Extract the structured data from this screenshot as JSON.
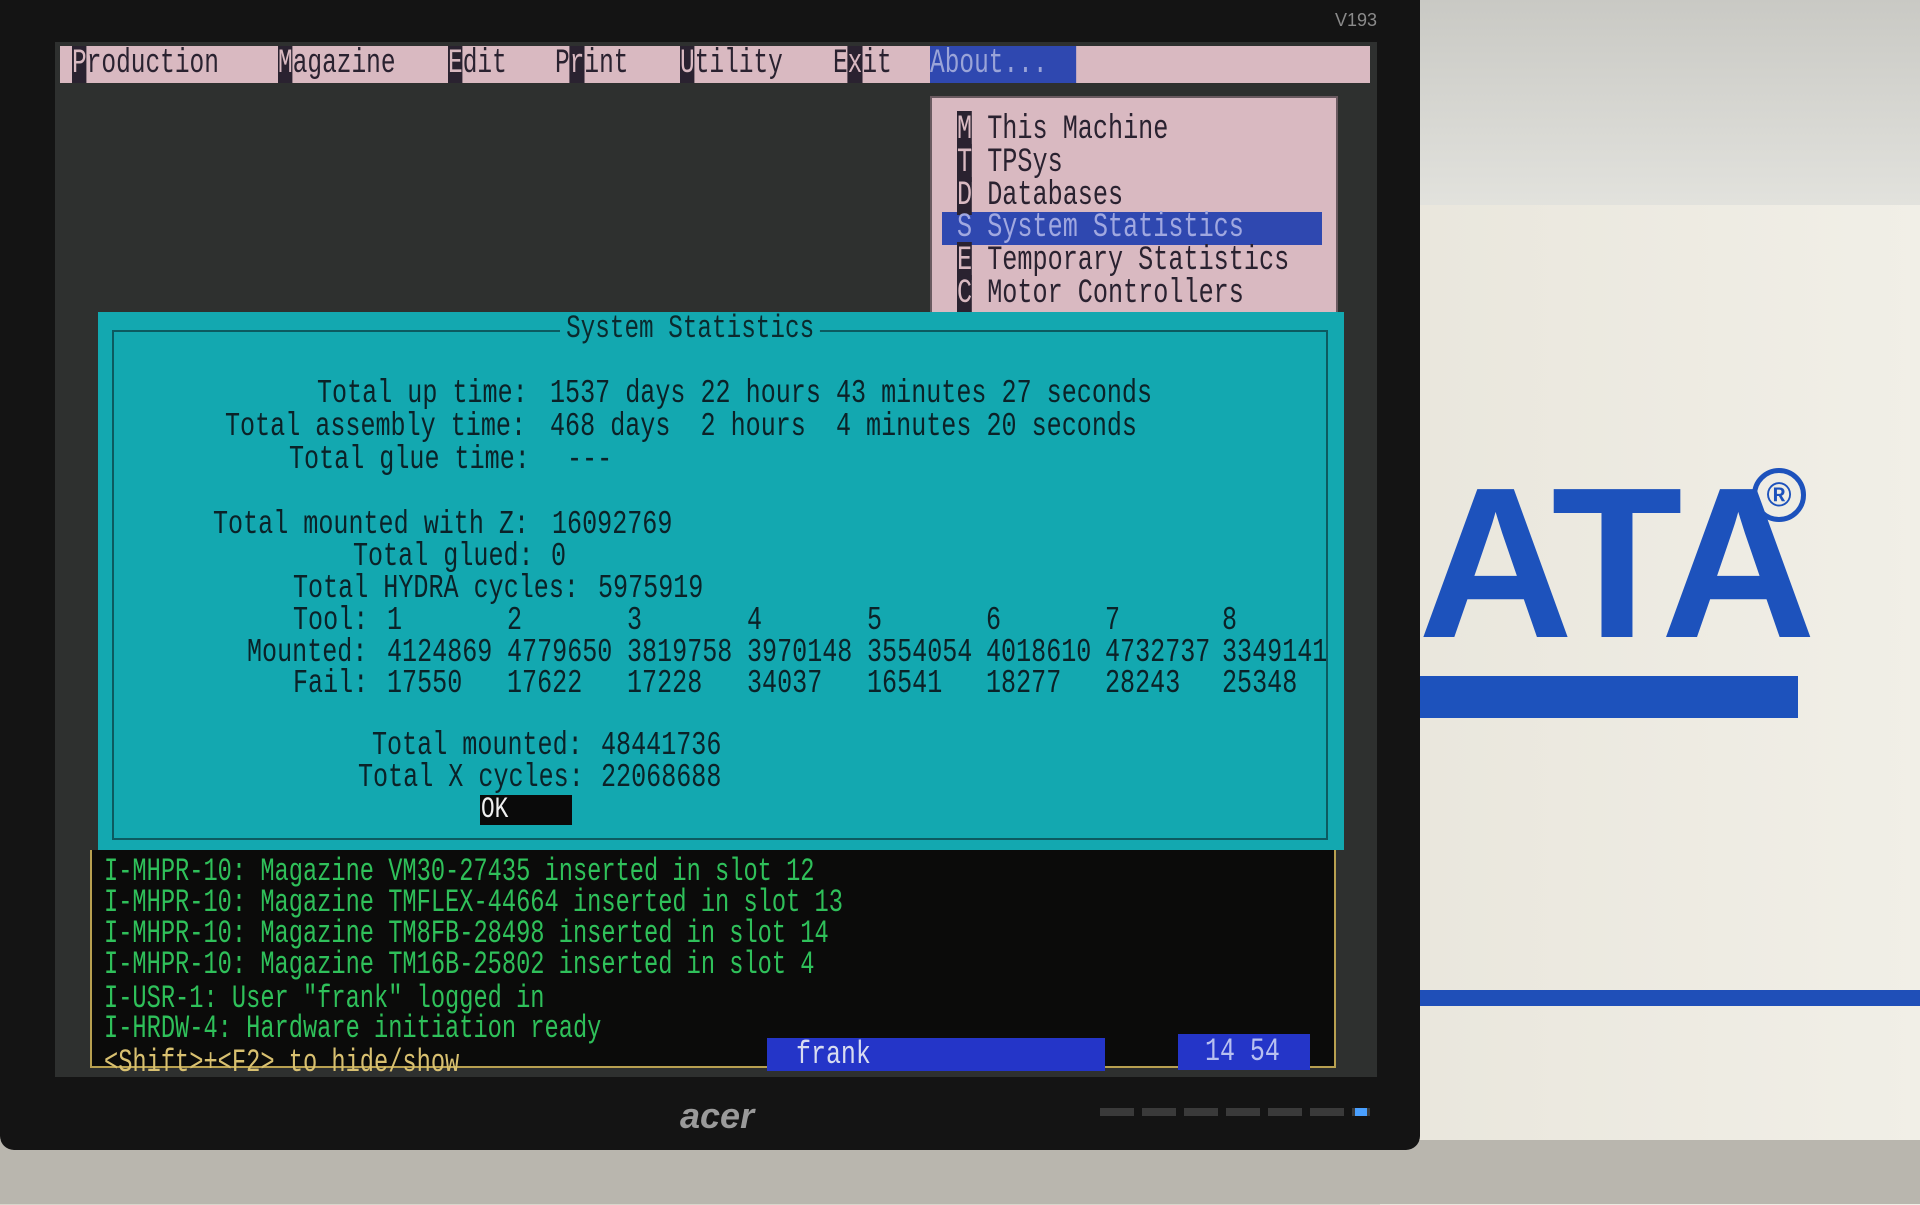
{
  "monitor": {
    "model": "V193",
    "brand": "acer"
  },
  "background_logo": {
    "text": "ATA",
    "registered": "®"
  },
  "menubar": {
    "items": [
      {
        "label": "Production",
        "hotkey": "P"
      },
      {
        "label": "Magazine",
        "hotkey": "M"
      },
      {
        "label": "Edit",
        "hotkey": "E"
      },
      {
        "label": "Print",
        "hotkey": "r"
      },
      {
        "label": "Utility",
        "hotkey": "U"
      },
      {
        "label": "Exit",
        "hotkey": "x"
      },
      {
        "label": "About...",
        "hotkey": "A",
        "active": true
      }
    ]
  },
  "about_menu": {
    "items": [
      {
        "hotkey": "M",
        "label": "This Machine"
      },
      {
        "hotkey": "T",
        "label": "TPSys"
      },
      {
        "hotkey": "D",
        "label": "Databases"
      },
      {
        "hotkey": "S",
        "label": "System Statistics",
        "selected": true
      },
      {
        "hotkey": "E",
        "label": "Temporary Statistics"
      },
      {
        "hotkey": "C",
        "label": "Motor Controllers"
      }
    ]
  },
  "dialog": {
    "title": "System Statistics",
    "up_time": {
      "label": "Total up time:",
      "value": "1537 days 22 hours 43 minutes 27 seconds"
    },
    "assembly_time": {
      "label": "Total assembly time:",
      "value": "468 days  2 hours  4 minutes 20 seconds"
    },
    "glue_time": {
      "label": "Total glue time:",
      "value": "---"
    },
    "mounted_with_z": {
      "label": "Total mounted with Z:",
      "value": "16092769"
    },
    "glued": {
      "label": "Total glued:",
      "value": "0"
    },
    "hydra_cycles": {
      "label": "Total HYDRA cycles:",
      "value": "5975919"
    },
    "tool_label": "Tool:",
    "mounted_label": "Mounted:",
    "fail_label": "Fail:",
    "tools": [
      {
        "tool": "1",
        "mounted": "4124869",
        "fail": "17550"
      },
      {
        "tool": "2",
        "mounted": "4779650",
        "fail": "17622"
      },
      {
        "tool": "3",
        "mounted": "3819758",
        "fail": "17228"
      },
      {
        "tool": "4",
        "mounted": "3970148",
        "fail": "34037"
      },
      {
        "tool": "5",
        "mounted": "3554054",
        "fail": "16541"
      },
      {
        "tool": "6",
        "mounted": "4018610",
        "fail": "18277"
      },
      {
        "tool": "7",
        "mounted": "4732737",
        "fail": "28243"
      },
      {
        "tool": "8",
        "mounted": "3349141",
        "fail": "25348"
      }
    ],
    "total_mounted": {
      "label": "Total mounted:",
      "value": "48441736"
    },
    "x_cycles": {
      "label": "Total X cycles:",
      "value": "22068688"
    },
    "ok_label": "OK"
  },
  "log": {
    "lines": [
      "I-MHPR-10: Magazine VM30-27435 inserted in slot 12",
      "I-MHPR-10: Magazine TMFLEX-44664 inserted in slot 13",
      "I-MHPR-10: Magazine TM8FB-28498 inserted in slot 14",
      "I-MHPR-10: Magazine TM16B-25802 inserted in slot 4",
      "I-USR-1: User \"frank\" logged in",
      "I-HRDW-4: Hardware initiation ready"
    ],
    "hint": "<Shift>+<F2> to hide/show"
  },
  "status": {
    "user": "frank",
    "time": "14 54"
  },
  "colors": {
    "menu_bg": "#d9b9c1",
    "selection": "#2f48b0",
    "dialog_bg": "#13a8b0",
    "log_text": "#2fc05a",
    "status_bg": "#2435c8",
    "logo_blue": "#1d52bc"
  }
}
